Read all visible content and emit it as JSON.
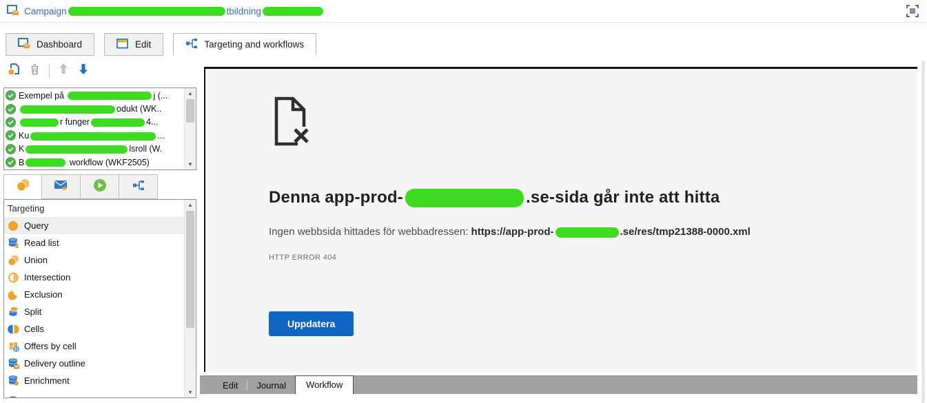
{
  "header": {
    "title_segments": [
      {
        "text": "Campaign"
      },
      {
        "redact": 228
      },
      {
        "text": "tbildning "
      },
      {
        "redact": 88
      }
    ]
  },
  "main_tabs": {
    "tabs": [
      {
        "label": "Dashboard",
        "icon": "dashboard-icon",
        "active": false
      },
      {
        "label": "Edit",
        "icon": "edit-tab-icon",
        "active": false
      },
      {
        "label": "Targeting and workflows",
        "icon": "workflow-icon",
        "active": true
      }
    ]
  },
  "sidebar": {
    "toolbar": {
      "buttons": [
        {
          "name": "add-workflow-button",
          "icon": "add-workflow-icon",
          "enabled": true
        },
        {
          "name": "delete-workflow-button",
          "icon": "trash-icon",
          "enabled": false
        },
        {
          "name": "separator",
          "icon": "separator",
          "enabled": false
        },
        {
          "name": "move-up-button",
          "icon": "arrow-up-icon",
          "enabled": false
        },
        {
          "name": "move-down-button",
          "icon": "arrow-down-icon",
          "enabled": true
        }
      ]
    },
    "workflows": [
      {
        "segments": [
          {
            "text": "Exempel på "
          },
          {
            "redact": 122
          },
          {
            "text": "j (..."
          }
        ]
      },
      {
        "segments": [
          {
            "redact": 138
          },
          {
            "text": "odukt (WK.."
          }
        ]
      },
      {
        "segments": [
          {
            "redact": 56
          },
          {
            "text": "r funger"
          },
          {
            "redact": 78
          },
          {
            "text": "4..."
          }
        ]
      },
      {
        "segments": [
          {
            "text": "Ku"
          },
          {
            "redact": 182
          },
          {
            "text": "..."
          }
        ]
      },
      {
        "segments": [
          {
            "text": "K"
          },
          {
            "redact": 148
          },
          {
            "text": "lsroll (W."
          }
        ]
      },
      {
        "segments": [
          {
            "text": "B"
          },
          {
            "redact": 58
          },
          {
            "text": " workflow (WKF2505)"
          }
        ]
      }
    ],
    "palette_tabs": [
      {
        "name": "tab-targeting",
        "icon": "targeting-tab-icon",
        "active": true
      },
      {
        "name": "tab-deliveries",
        "icon": "deliveries-tab-icon",
        "active": false
      },
      {
        "name": "tab-execution",
        "icon": "execution-tab-icon",
        "active": false
      },
      {
        "name": "tab-flow-control",
        "icon": "flow-tab-icon",
        "active": false
      }
    ],
    "palette": {
      "header": "Targeting",
      "items": [
        {
          "label": "Query",
          "icon": "query-icon",
          "selected": true
        },
        {
          "label": "Read list",
          "icon": "read-list-icon",
          "selected": false
        },
        {
          "label": "Union",
          "icon": "union-icon",
          "selected": false
        },
        {
          "label": "Intersection",
          "icon": "intersection-icon",
          "selected": false
        },
        {
          "label": "Exclusion",
          "icon": "exclusion-icon",
          "selected": false
        },
        {
          "label": "Split",
          "icon": "split-icon",
          "selected": false
        },
        {
          "label": "Cells",
          "icon": "cells-icon",
          "selected": false
        },
        {
          "label": "Offers by cell",
          "icon": "offers-by-cell-icon",
          "selected": false
        },
        {
          "label": "Delivery outline",
          "icon": "delivery-outline-icon",
          "selected": false
        },
        {
          "label": "Enrichment",
          "icon": "enrichment-icon",
          "selected": false
        },
        {
          "label": "",
          "icon": "clipped-item-icon",
          "selected": false
        }
      ]
    }
  },
  "error_page": {
    "heading_segments": [
      {
        "text": "Denna app-prod-"
      },
      {
        "redact": 172
      },
      {
        "text": ".se-sida går inte att hitta"
      }
    ],
    "message_prefix": "Ingen webbsida hittades för webbadressen: ",
    "url_segments": [
      {
        "text": "https://app-prod-"
      },
      {
        "redact": 92
      },
      {
        "text": ".se/res/tmp21388-0000.xml"
      }
    ],
    "error_code": "HTTP ERROR 404",
    "reload_label": "Uppdatera"
  },
  "bottom_tabs": {
    "tabs": [
      {
        "label": "Edit",
        "active": false
      },
      {
        "label": "Journal",
        "active": false
      },
      {
        "label": "Workflow",
        "active": true
      }
    ]
  },
  "colors": {
    "accent_blue": "#2e79c7",
    "accent_orange": "#f0a22d",
    "button_blue": "#1266c3",
    "redaction_green": "#3edc21",
    "check_green": "#52b152"
  }
}
